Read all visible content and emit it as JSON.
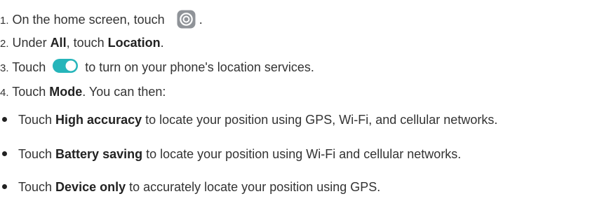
{
  "steps": [
    {
      "num": "1.",
      "before": "On the home screen, touch",
      "after": "."
    },
    {
      "num": "2.",
      "t1": "Under ",
      "b1": "All",
      "t2": ", touch ",
      "b2": "Location",
      "t3": "."
    },
    {
      "num": "3.",
      "before": "Touch",
      "after": "to turn on your phone's location services."
    },
    {
      "num": "4.",
      "t1": "Touch ",
      "b1": "Mode",
      "t2": ". You can then:"
    }
  ],
  "bullets": [
    {
      "t1": "Touch ",
      "b1": "High accuracy",
      "t2": " to locate your position using GPS, Wi-Fi, and cellular networks."
    },
    {
      "t1": "Touch ",
      "b1": "Battery saving",
      "t2": " to locate your position using Wi-Fi and cellular networks."
    },
    {
      "t1": "Touch ",
      "b1": "Device only",
      "t2": " to accurately locate your position using GPS."
    }
  ],
  "icons": {
    "settings": "settings-icon",
    "toggle": "toggle-switch-icon"
  },
  "colors": {
    "toggle_accent": "#26b5ba",
    "settings_icon_bg": "#8f9398"
  }
}
